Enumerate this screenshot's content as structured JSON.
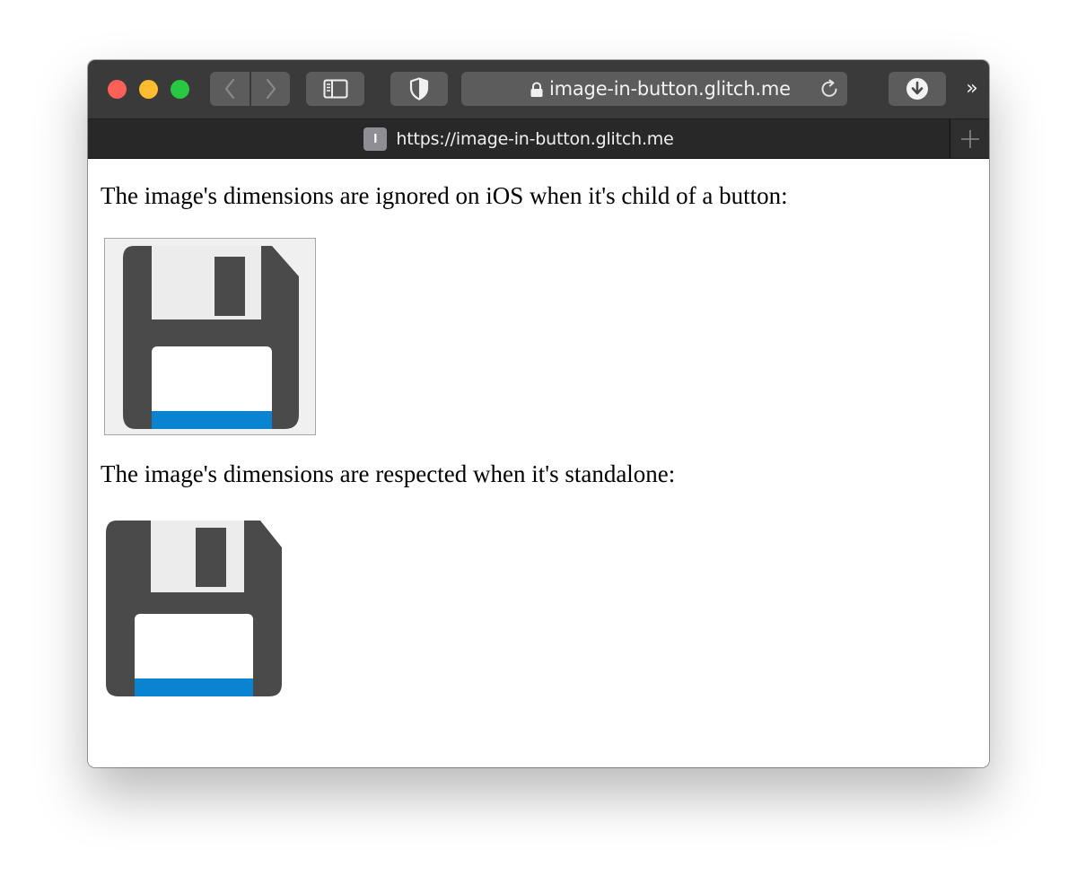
{
  "browser": {
    "address_url": "image-in-button.glitch.me",
    "tab": {
      "favicon_letter": "I",
      "title": "https://image-in-button.glitch.me"
    },
    "overflow_label": "››"
  },
  "page": {
    "para_button": "The image's dimensions are ignored on iOS when it's child of a button:",
    "para_standalone": "The image's dimensions are respected when it's standalone:"
  },
  "icons": {
    "floppy": "floppy-disk-icon"
  },
  "colors": {
    "toolbar": "#3a3a3a",
    "tabbar": "#282828",
    "traffic_red": "#fe5f57",
    "traffic_yellow": "#febc2e",
    "traffic_green": "#28c840",
    "floppy_body": "#4a4a4a",
    "floppy_label": "#0a84d0"
  }
}
